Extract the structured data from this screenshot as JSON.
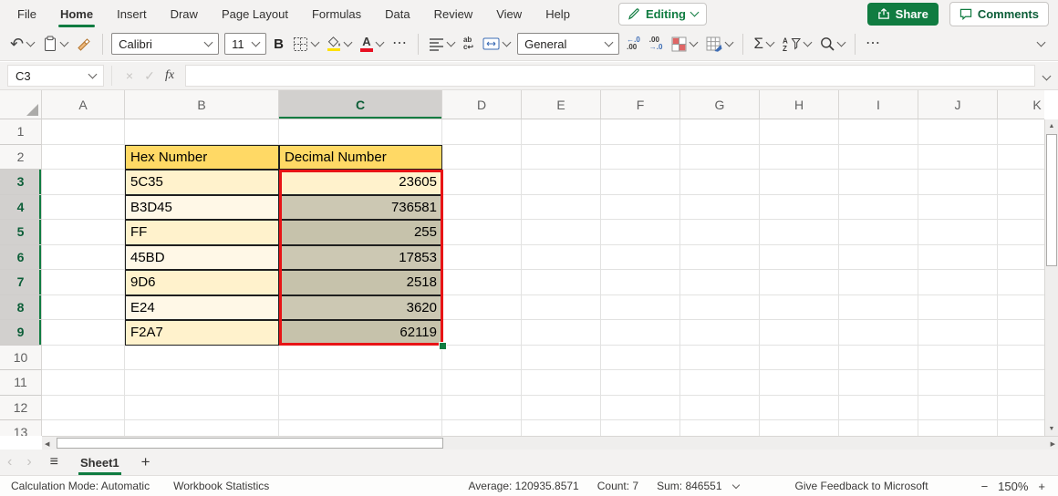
{
  "menu": {
    "tabs": [
      "File",
      "Home",
      "Insert",
      "Draw",
      "Page Layout",
      "Formulas",
      "Data",
      "Review",
      "View",
      "Help"
    ],
    "active_tab": "Home",
    "editing_label": "Editing",
    "share_label": "Share",
    "comments_label": "Comments"
  },
  "toolbar": {
    "font_name": "Calibri",
    "font_size": "11",
    "number_format": "General"
  },
  "formula_bar": {
    "cell_reference": "C3",
    "formula_value": ""
  },
  "grid": {
    "column_headers": [
      "A",
      "B",
      "C",
      "D",
      "E",
      "F",
      "G",
      "H",
      "I",
      "J",
      "K"
    ],
    "row_headers": [
      "1",
      "2",
      "3",
      "4",
      "5",
      "6",
      "7",
      "8",
      "9",
      "10",
      "11",
      "12",
      "13"
    ],
    "selected_column": "C",
    "selected_row_start": 3,
    "selected_row_end": 9
  },
  "table": {
    "headers": [
      "Hex Number",
      "Decimal Number"
    ],
    "rows": [
      {
        "row": 3,
        "hex": "5C35",
        "decimal": "23605"
      },
      {
        "row": 4,
        "hex": "B3D45",
        "decimal": "736581"
      },
      {
        "row": 5,
        "hex": "FF",
        "decimal": "255"
      },
      {
        "row": 6,
        "hex": "45BD",
        "decimal": "17853"
      },
      {
        "row": 7,
        "hex": "9D6",
        "decimal": "2518"
      },
      {
        "row": 8,
        "hex": "E24",
        "decimal": "3620"
      },
      {
        "row": 9,
        "hex": "F2A7",
        "decimal": "62119"
      }
    ]
  },
  "sheet_bar": {
    "sheet_name": "Sheet1"
  },
  "status_bar": {
    "calculation_mode": "Calculation Mode: Automatic",
    "workbook_statistics": "Workbook Statistics",
    "average": "Average: 120935.8571",
    "count": "Count: 7",
    "sum": "Sum: 846551",
    "feedback": "Give Feedback to Microsoft",
    "zoom_level": "150%"
  },
  "icons": {
    "undo": "↶",
    "bold": "B",
    "more": "⋯",
    "sigma": "Σ",
    "font_color_letter": "A",
    "wrap_line1": "ab",
    "wrap_line2": "c↩",
    "dec_line1": "←.0",
    "dec_line2": ".00",
    "inc_line1": ".00",
    "inc_line2": "→.0",
    "cancel": "×",
    "enter": "✓",
    "fx": "fx",
    "hamburger": "≡",
    "sheet_prev": "‹",
    "sheet_next": "›",
    "add_sheet": "+",
    "zoom_out": "−",
    "zoom_in": "+",
    "arrow_up": "▲",
    "arrow_down": "▼",
    "arrow_left": "◀",
    "arrow_right": "▶"
  },
  "colors": {
    "accent_green": "#107C41",
    "table_header_fill": "#FFD965",
    "row_fill_odd": "#FFF2CC",
    "row_fill_even": "#FFF8E7",
    "selection_fill": "#C6C2AB",
    "selection_border": "#E81416",
    "font_color_bar": "#E81123",
    "fill_color_bar": "#FFE100"
  }
}
